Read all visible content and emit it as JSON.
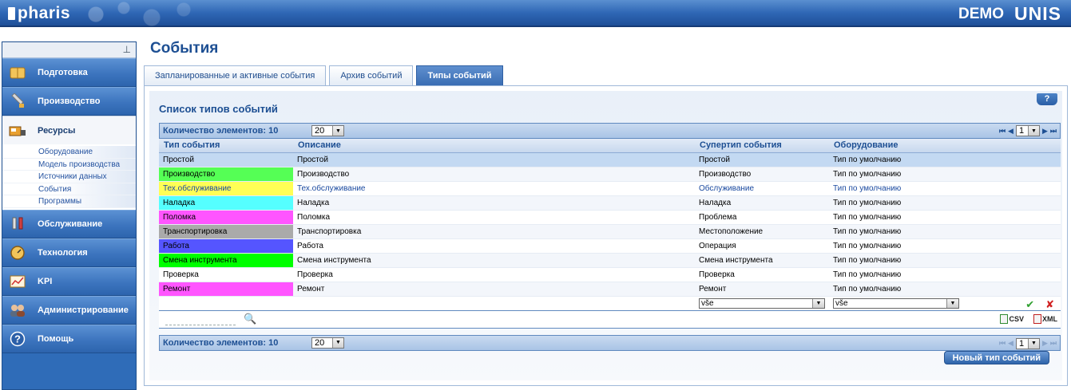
{
  "header": {
    "logo": "pharis",
    "demo": "DEMO",
    "brand": "UNIS"
  },
  "sidebar": {
    "pin": "⊥",
    "items": [
      {
        "label": "Подготовка",
        "icon": "book-icon"
      },
      {
        "label": "Производство",
        "icon": "production-icon"
      },
      {
        "label": "Ресурсы",
        "icon": "resources-icon"
      },
      {
        "label": "Обслуживание",
        "icon": "wrench-icon"
      },
      {
        "label": "Технология",
        "icon": "gauge-icon"
      },
      {
        "label": "KPI",
        "icon": "chart-icon"
      },
      {
        "label": "Администрирование",
        "icon": "users-icon"
      },
      {
        "label": "Помощь",
        "icon": "help-icon"
      }
    ],
    "sub_items": [
      "Оборудование",
      "Модель производства",
      "Источники данных",
      "События",
      "Программы"
    ]
  },
  "page": {
    "title": "События",
    "tabs": [
      "Запланированные и активные события",
      "Архив событий",
      "Типы событий"
    ],
    "active_tab": 2,
    "help": "?",
    "list_title": "Список типов событий",
    "count_label": "Количество элементов: 10",
    "page_size": "20",
    "page_number": "1",
    "new_button": "Новый тип событий"
  },
  "table": {
    "columns": [
      "Тип события",
      "Описание",
      "Супертип события",
      "Оборудование"
    ],
    "rows": [
      {
        "type": "Простой",
        "desc": "Простой",
        "super": "Простой",
        "equip": "Тип по умолчанию",
        "color": "#c3d9f2"
      },
      {
        "type": "Производство",
        "desc": "Производство",
        "super": "Производство",
        "equip": "Тип по умолчанию",
        "color": "#55ff55"
      },
      {
        "type": "Тех.обслуживание",
        "desc": "Тех.обслуживание",
        "super": "Обслуживание",
        "equip": "Тип по умолчанию",
        "color": "#ffff55"
      },
      {
        "type": "Наладка",
        "desc": "Наладка",
        "super": "Наладка",
        "equip": "Тип по умолчанию",
        "color": "#55ffff"
      },
      {
        "type": "Поломка",
        "desc": "Поломка",
        "super": "Проблема",
        "equip": "Тип по умолчанию",
        "color": "#ff55ff"
      },
      {
        "type": "Транспортировка",
        "desc": "Транспортировка",
        "super": "Местоположение",
        "equip": "Тип по умолчанию",
        "color": "#aaaaaa"
      },
      {
        "type": "Работа",
        "desc": "Работа",
        "super": "Операция",
        "equip": "Тип по умолчанию",
        "color": "#5555ff"
      },
      {
        "type": "Смена инструмента",
        "desc": "Смена инструмента",
        "super": "Смена инструмента",
        "equip": "Тип по умолчанию",
        "color": "#00ff00"
      },
      {
        "type": "Проверка",
        "desc": "Проверка",
        "super": "Проверка",
        "equip": "Тип по умолчанию",
        "color": "#ffffff"
      },
      {
        "type": "Ремонт",
        "desc": "Ремонт",
        "super": "Ремонт",
        "equip": "Тип по умолчанию",
        "color": "#ff55ff"
      }
    ],
    "filter_super": "vše",
    "filter_equip": "vše",
    "export_csv": "CSV",
    "export_xml": "XML"
  }
}
